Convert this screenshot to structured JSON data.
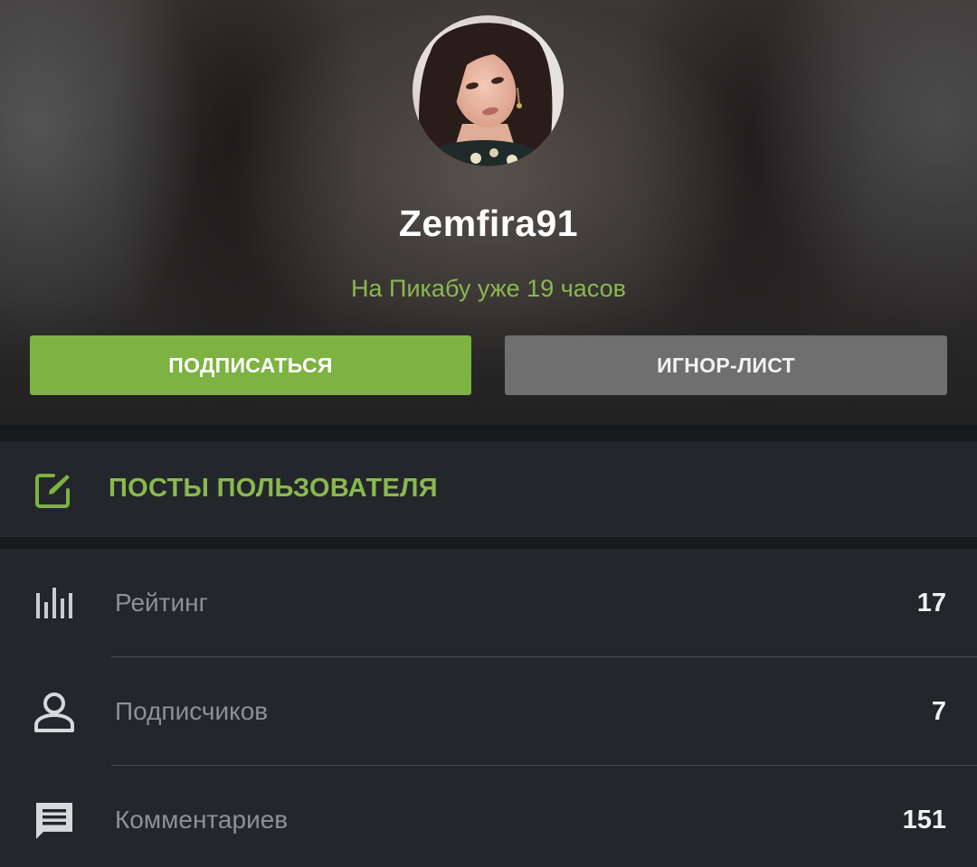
{
  "profile": {
    "username": "Zemfira91",
    "since_text": "На Пикабу уже 19 часов"
  },
  "actions": {
    "subscribe_label": "ПОДПИСАТЬСЯ",
    "ignore_label": "ИГНОР-ЛИСТ"
  },
  "posts": {
    "label": "ПОСТЫ ПОЛЬЗОВАТЕЛЯ",
    "icon": "edit-icon"
  },
  "stats": [
    {
      "label": "Рейтинг",
      "value": "17",
      "icon": "bar-chart-icon"
    },
    {
      "label": "Подписчиков",
      "value": "7",
      "icon": "person-icon"
    },
    {
      "label": "Комментариев",
      "value": "151",
      "icon": "comment-icon"
    }
  ],
  "colors": {
    "accent_green": "#7cb342",
    "text_green": "#8ab84f",
    "ignore_button": "#6f6f6f",
    "panel": "#23272b"
  }
}
